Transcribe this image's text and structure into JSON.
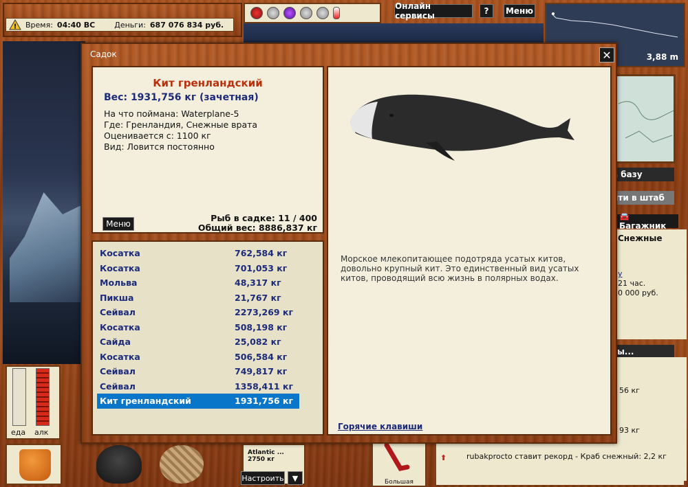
{
  "status": {
    "time_label": "Время:",
    "time_value": "04:40 ВС",
    "money_label": "Деньги:",
    "money_value": "687 076 834 руб."
  },
  "topbar": {
    "online_services": "Онлайн сервисы",
    "help": "?",
    "menu": "Меню"
  },
  "depth": {
    "value": "3,88 m"
  },
  "side": {
    "to_base": "а базу",
    "to_hq": "йти в штаб",
    "trunk": "🚘 Багажник",
    "info_title": "Снежные",
    "info_link": "y",
    "info_time": "21 час.",
    "info_money": "0 000 руб.",
    "more_btn": "ты...",
    "chat_1": "56 кг",
    "chat_2": "93 кг"
  },
  "meters": {
    "food_label": "еда",
    "alc_label": "алк",
    "food_level": 0,
    "alc_level": 1.0
  },
  "lure": {
    "name": "Atlantic ...",
    "weight": "2750 кг",
    "setup": "Настроить",
    "arrow": "▼"
  },
  "rod": {
    "label": "Большая"
  },
  "record": {
    "text": "rubakprocto ставит рекорд - Краб снежный: 2,2 кг"
  },
  "dialog": {
    "title": "Садок",
    "close": "✕",
    "fish": {
      "name": "Кит гренландский",
      "weight": "Вес: 1931,756 кг (зачетная)",
      "caught_with": "На что поймана: Waterplane-5",
      "where": "Где: Гренландия, Снежные врата",
      "rated_from": "Оценивается с: 1100 кг",
      "kind": "Вид: Ловится постоянно"
    },
    "menu": "Меню",
    "tank_count": "Рыб в садке: 11 / 400",
    "tank_weight": "Общий вес: 8886,837 кг",
    "list": [
      {
        "name": "Косатка",
        "weight": "762,584 кг"
      },
      {
        "name": "Косатка",
        "weight": "701,053 кг"
      },
      {
        "name": "Мольва",
        "weight": "48,317 кг"
      },
      {
        "name": "Пикша",
        "weight": "21,767 кг"
      },
      {
        "name": "Сейвал",
        "weight": "2273,269 кг"
      },
      {
        "name": "Косатка",
        "weight": "508,198 кг"
      },
      {
        "name": "Сайда",
        "weight": "25,082 кг"
      },
      {
        "name": "Косатка",
        "weight": "506,584 кг"
      },
      {
        "name": "Сейвал",
        "weight": "749,817 кг"
      },
      {
        "name": "Сейвал",
        "weight": "1358,411 кг"
      },
      {
        "name": "Кит гренландский",
        "weight": "1931,756 кг"
      }
    ],
    "description": "Морское млекопитающее подотряда усатых китов, довольно крупный кит. Это единственный вид усатых китов, проводящий всю жизнь в полярных водах.",
    "hotkeys": "Горячие клавиши"
  }
}
